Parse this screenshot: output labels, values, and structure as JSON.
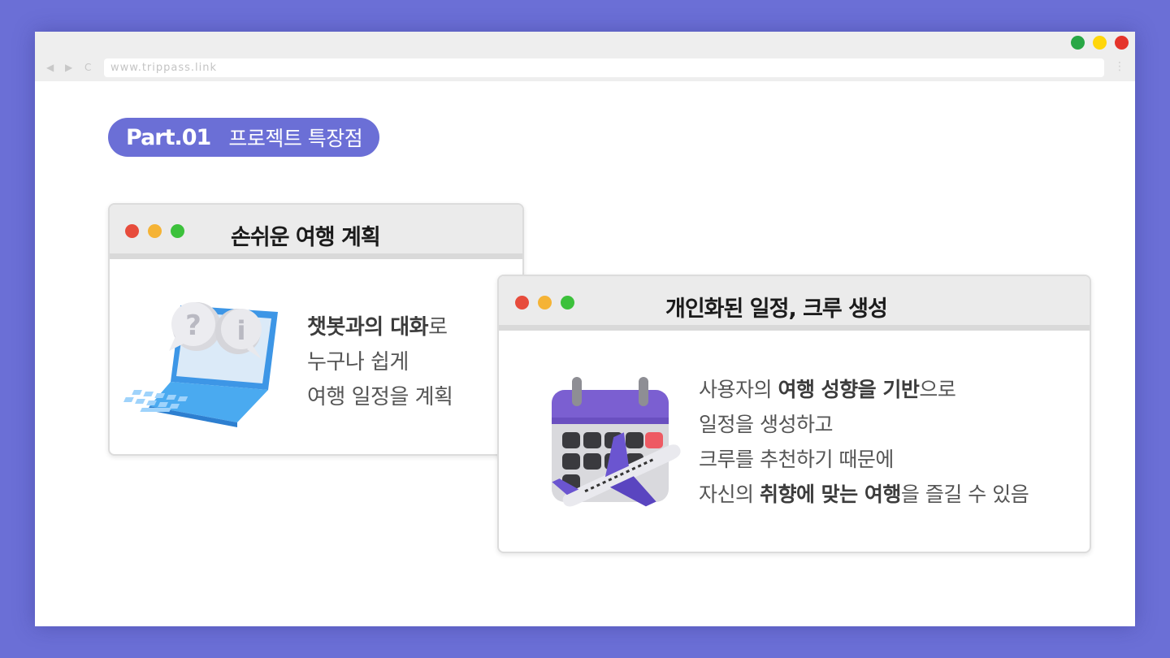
{
  "browser": {
    "url": "www.trippass.link",
    "window_controls": [
      {
        "name": "maximize",
        "color": "#28a745"
      },
      {
        "name": "minimize",
        "color": "#ffd60a"
      },
      {
        "name": "close",
        "color": "#e5342b"
      }
    ],
    "nav_icons": [
      "back-icon",
      "forward-icon",
      "reload-icon",
      "more-icon"
    ],
    "nav_glyphs": {
      "back": "◀",
      "forward": "▶",
      "reload": "C",
      "more": "⋮"
    }
  },
  "section": {
    "label": "Part.01",
    "title": "프로젝트 특장점",
    "accent": "#6b6fd6"
  },
  "cards": [
    {
      "title": "손쉬운 여행 계획",
      "icon": "laptop-chat-icon",
      "lines": [
        [
          {
            "t": "챗봇과의 대화",
            "b": true
          },
          {
            "t": "로",
            "b": false
          }
        ],
        [
          {
            "t": "누구나 쉽게",
            "b": false
          }
        ],
        [
          {
            "t": "여행 일정을 계획",
            "b": false
          }
        ]
      ]
    },
    {
      "title": "개인화된 일정, 크루 생성",
      "icon": "calendar-plane-icon",
      "lines": [
        [
          {
            "t": "사용자의 ",
            "b": false
          },
          {
            "t": "여행 성향을 기반",
            "b": true
          },
          {
            "t": "으로",
            "b": false
          }
        ],
        [
          {
            "t": "일정을 생성하고",
            "b": false
          }
        ],
        [
          {
            "t": "크루를 추천하기 때문에",
            "b": false
          }
        ],
        [
          {
            "t": "자신의 ",
            "b": false
          },
          {
            "t": "취향에 맞는 여행",
            "b": true
          },
          {
            "t": "을 즐길 수 있음",
            "b": false
          }
        ]
      ]
    }
  ],
  "card_dot_colors": [
    "#e74c3c",
    "#f5b335",
    "#3cc13b"
  ]
}
